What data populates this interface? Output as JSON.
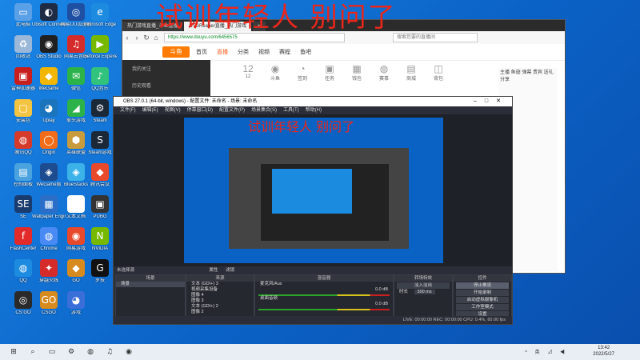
{
  "overlay_text": "试训年轻人 别问了",
  "desktop_icons": [
    {
      "label": "此电脑",
      "glyph": "▭",
      "color": "#5aa0e6"
    },
    {
      "label": "Ubisoft Connect",
      "glyph": "◐",
      "color": "#1f2a44"
    },
    {
      "label": "网易UU加速器",
      "glyph": "◎",
      "color": "#1e4fa3"
    },
    {
      "label": "Microsoft Edge",
      "glyph": "e",
      "color": "#1d8be0"
    },
    {
      "label": "回收站",
      "glyph": "♻",
      "color": "#9bb8d8"
    },
    {
      "label": "OBS Studio",
      "glyph": "◉",
      "color": "#202020"
    },
    {
      "label": "网易云音乐",
      "glyph": "♫",
      "color": "#d62b2b"
    },
    {
      "label": "Geforce Experience",
      "glyph": "▶",
      "color": "#76b900"
    },
    {
      "label": "雷神加速器",
      "glyph": "▣",
      "color": "#c81e1e"
    },
    {
      "label": "WeGame",
      "glyph": "◆",
      "color": "#f2b705"
    },
    {
      "label": "微信",
      "glyph": "✉",
      "color": "#2bb34a"
    },
    {
      "label": "QQ音乐",
      "glyph": "♪",
      "color": "#31c27c"
    },
    {
      "label": "安装包",
      "glyph": "▢",
      "color": "#f4c542"
    },
    {
      "label": "Uplay",
      "glyph": "◕",
      "color": "#1b75bc"
    },
    {
      "label": "拳头游戏",
      "glyph": "◢",
      "color": "#2bb34a"
    },
    {
      "label": "Steam",
      "glyph": "⚙",
      "color": "#1b2838"
    },
    {
      "label": "腾讯QQ",
      "glyph": "◍",
      "color": "#d63a2b"
    },
    {
      "label": "Origin",
      "glyph": "◯",
      "color": "#f26c1a"
    },
    {
      "label": "英雄联盟",
      "glyph": "⬢",
      "color": "#c89b3c"
    },
    {
      "label": "Steam游戏",
      "glyph": "S",
      "color": "#1b2838"
    },
    {
      "label": "控制面板",
      "glyph": "▤",
      "color": "#4aa3df"
    },
    {
      "label": "WeGame版",
      "glyph": "◈",
      "color": "#1d4b8f"
    },
    {
      "label": "BlueStacks",
      "glyph": "◈",
      "color": "#3bb3e8"
    },
    {
      "label": "腾讯会议",
      "glyph": "◆",
      "color": "#e8492a"
    },
    {
      "label": "SE",
      "glyph": "SE",
      "color": "#1a3b6e"
    },
    {
      "label": "Wallpaper Engine",
      "glyph": "▦",
      "color": "#2a6ec7"
    },
    {
      "label": "文本文档",
      "glyph": "▤",
      "color": "#ffffff"
    },
    {
      "label": "PUBG",
      "glyph": "▣",
      "color": "#333333"
    },
    {
      "label": "FlashCenter",
      "glyph": "f",
      "color": "#e22a2a"
    },
    {
      "label": "Chrome",
      "glyph": "◍",
      "color": "#4a8af4"
    },
    {
      "label": "网易游戏",
      "glyph": "◉",
      "color": "#e8492a"
    },
    {
      "label": "NVIDIA",
      "glyph": "N",
      "color": "#76b900"
    },
    {
      "label": "QQ",
      "glyph": "◍",
      "color": "#1d8be0"
    },
    {
      "label": "穿越火线",
      "glyph": "✦",
      "color": "#d62b2b"
    },
    {
      "label": "GO",
      "glyph": "◆",
      "color": "#d78a1e"
    },
    {
      "label": "罗技",
      "glyph": "G",
      "color": "#111111"
    },
    {
      "label": "CS:GO",
      "glyph": "◎",
      "color": "#2a2a2a"
    },
    {
      "label": "CSGO",
      "glyph": "GO",
      "color": "#d78a1e"
    },
    {
      "label": "游戏",
      "glyph": "◕",
      "color": "#3a6ed8"
    }
  ],
  "browser": {
    "tabs": [
      "热门游戏直播_斗鱼直播",
      "CTGReaper直播_热门游戏",
      "+"
    ],
    "url": "https://www.douyu.com/6456575",
    "search_placeholder": "搜索您要的直播间",
    "logo": "斗鱼",
    "nav": [
      "首页",
      "直播",
      "分类",
      "视频",
      "赛程",
      "鱼吧"
    ],
    "nav_active": 1,
    "side": [
      "我的关注",
      "历史观看"
    ],
    "cats": [
      {
        "g": "12",
        "t": "12"
      },
      {
        "g": "◉",
        "t": "斗鱼"
      },
      {
        "g": "◔",
        "t": "签到"
      },
      {
        "g": "▣",
        "t": "任务"
      },
      {
        "g": "▦",
        "t": "钱包"
      },
      {
        "g": "◍",
        "t": "赛事"
      },
      {
        "g": "▤",
        "t": "商城"
      },
      {
        "g": "◫",
        "t": "背包"
      }
    ],
    "right_text": "主播 鱼翅 弹幕 贵宾 送礼 分享"
  },
  "obs": {
    "title": "OBS 27.0.1 (64-bit, windows) - 配置文件: 未命名 - 场景: 未命名",
    "menu": [
      "文件(F)",
      "编辑(E)",
      "视图(V)",
      "停靠窗口(D)",
      "配置文件(P)",
      "场景集合(S)",
      "工具(T)",
      "帮助(H)"
    ],
    "preview_title": "试训年轻人 别问了",
    "strip_label": "未选择源",
    "strip_buttons": [
      "属性",
      "滤镜"
    ],
    "docks": {
      "scenes": {
        "title": "场景",
        "items": [
          "场景"
        ]
      },
      "sources": {
        "title": "来源",
        "items": [
          "文本 (GDI+) 3",
          "视频采集设备",
          "图像 4",
          "图像 3",
          "文本 (GDI+) 2",
          "图像 2"
        ]
      },
      "mixer": {
        "title": "混音器",
        "items": [
          {
            "name": "麦克风/Aux",
            "db": "0.0 dB"
          },
          {
            "name": "桌面音频",
            "db": "0.0 dB"
          }
        ]
      },
      "transitions": {
        "title": "转场特效",
        "type": "淡入淡出",
        "duration_label": "时长",
        "duration": "300 ms"
      },
      "controls": {
        "title": "控件",
        "buttons": [
          "停止推流",
          "开始录制",
          "启动虚拟摄像机",
          "工作室模式",
          "设置",
          "退出"
        ]
      }
    },
    "status": "LIVE: 00:00:00   REC: 00:00:00   CPU: 0.4%, 60.00 fps"
  },
  "taskbar": {
    "time": "13:42",
    "date": "2022/5/27",
    "tray": "^ 英 ⊿ ◀"
  }
}
